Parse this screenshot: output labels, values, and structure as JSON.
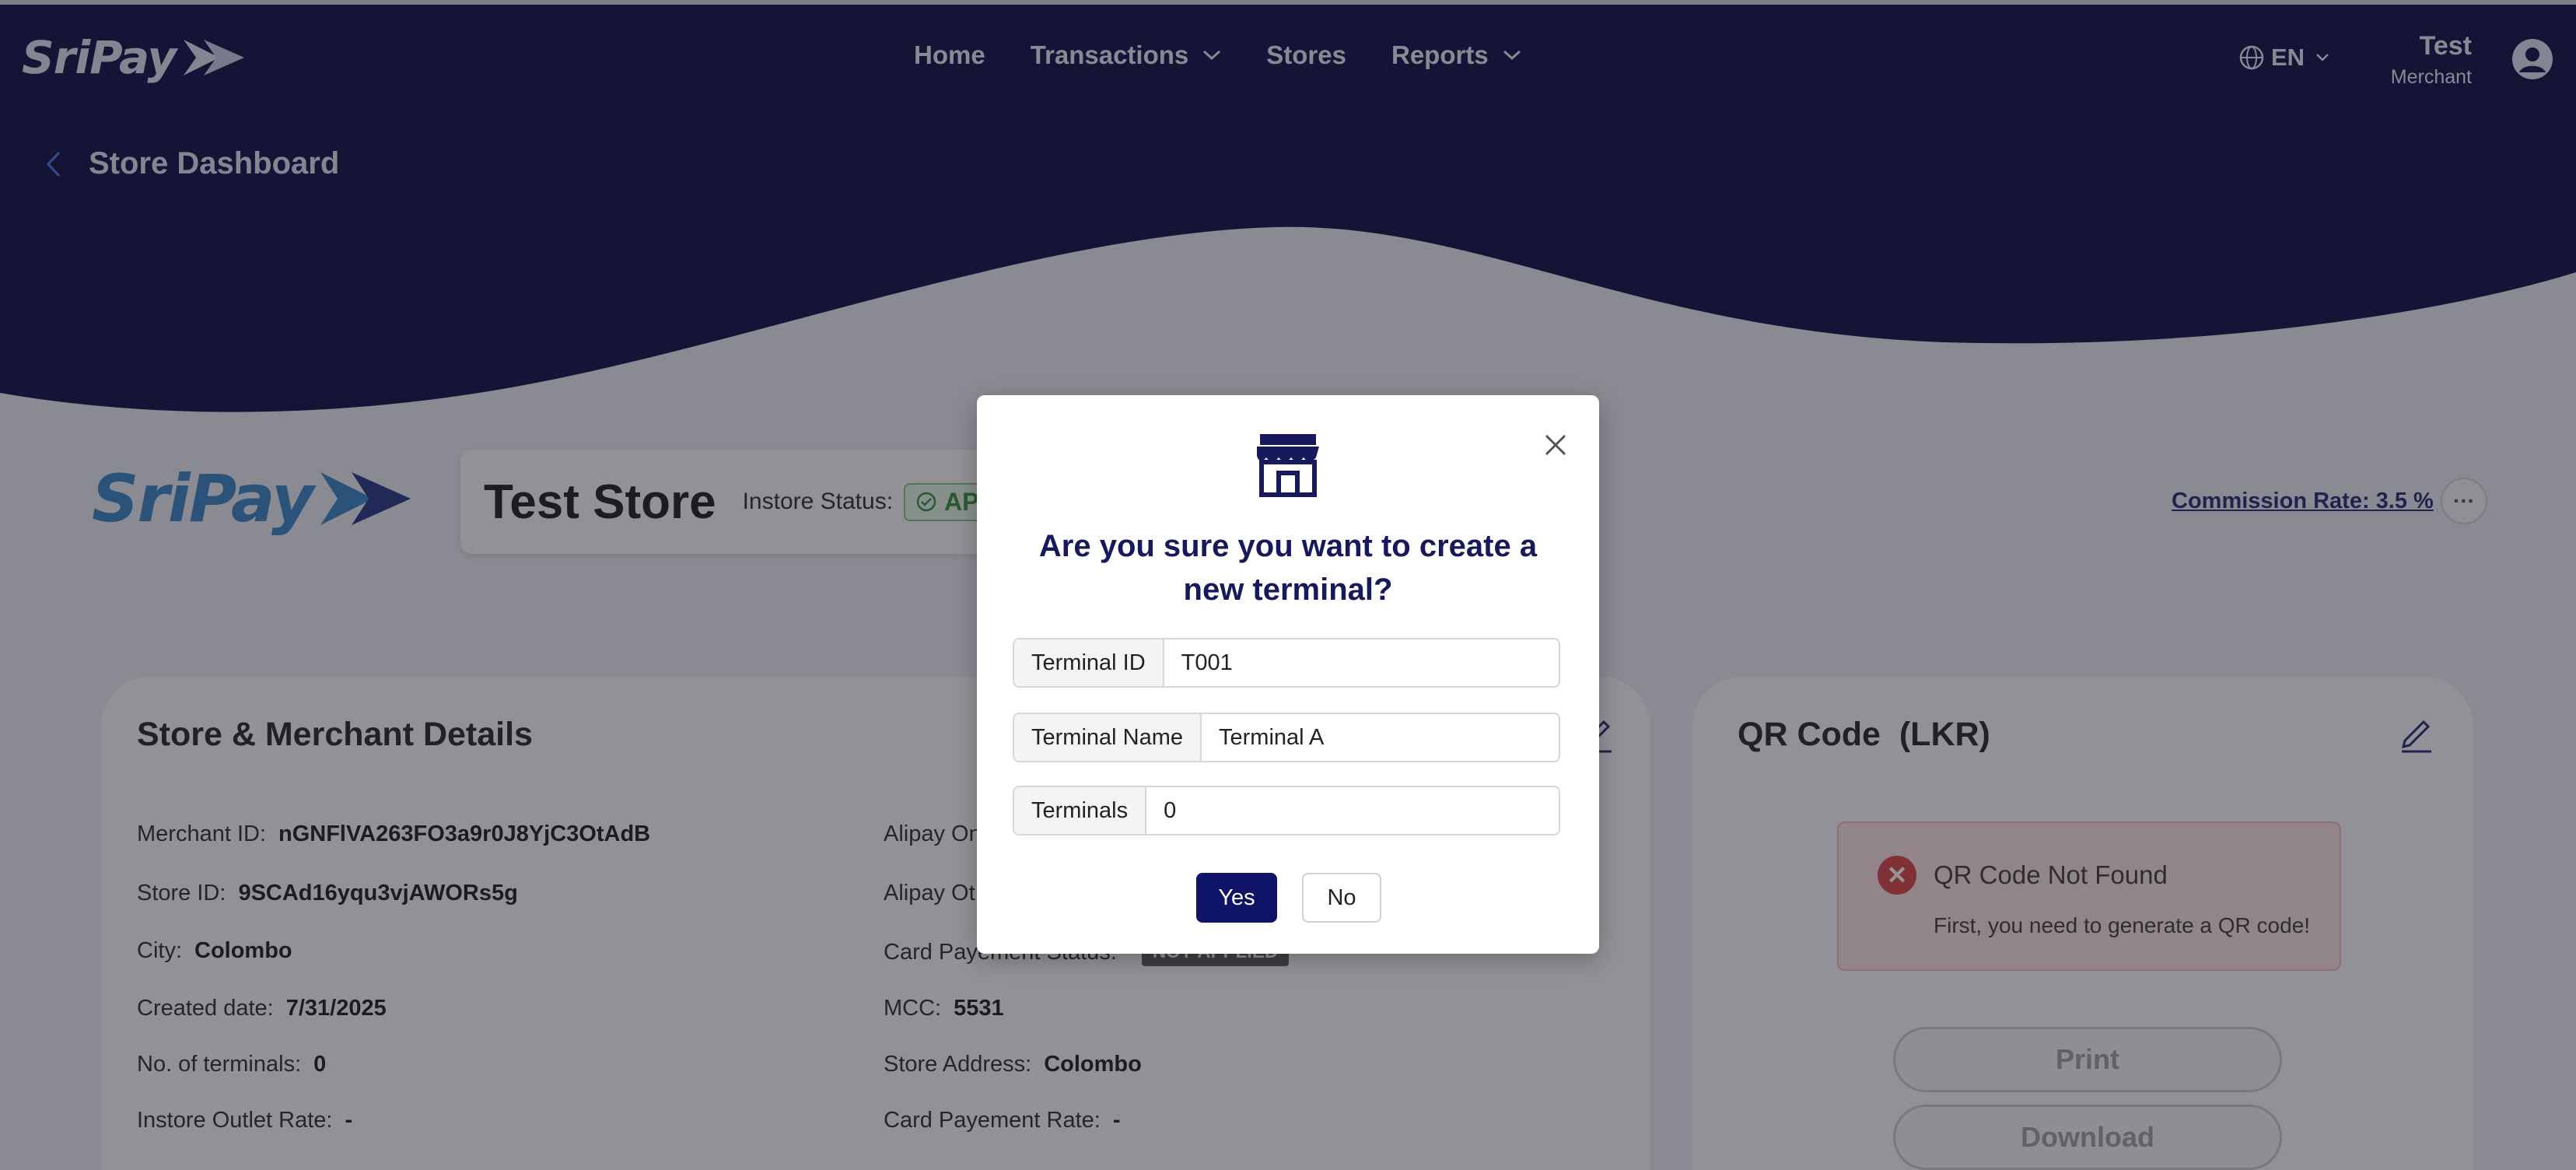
{
  "brand": {
    "name": "SriPay"
  },
  "nav": {
    "items": [
      {
        "label": "Home",
        "dropdown": false
      },
      {
        "label": "Transactions",
        "dropdown": true
      },
      {
        "label": "Stores",
        "dropdown": false
      },
      {
        "label": "Reports",
        "dropdown": true
      }
    ],
    "language": "EN",
    "user_name": "Test",
    "user_role": "Merchant"
  },
  "page": {
    "title": "Store Dashboard"
  },
  "store": {
    "name": "Test Store",
    "instore_status_label": "Instore Status:",
    "instore_status_value": "AP",
    "commission": "Commission Rate: 3.5 %",
    "more": "···"
  },
  "details": {
    "title": "Store & Merchant Details",
    "left": [
      {
        "label": "Merchant ID:",
        "value": "nGNFlVA263FO3a9r0J8YjC3OtAdB"
      },
      {
        "label": "Store ID:",
        "value": "9SCAd16yqu3vjAWORs5g"
      },
      {
        "label": "City:",
        "value": "Colombo"
      },
      {
        "label": "Created date:",
        "value": "7/31/2025"
      },
      {
        "label": "No. of terminals:",
        "value": "0"
      },
      {
        "label": "Instore Outlet Rate:",
        "value": "-"
      }
    ],
    "right": [
      {
        "label": "Alipay On",
        "value": ""
      },
      {
        "label": "Alipay Ot",
        "value": ""
      },
      {
        "label": "Card Payement Status:",
        "value": "NOT-APPLIED"
      },
      {
        "label": "MCC:",
        "value": "5531"
      },
      {
        "label": "Store Address:",
        "value": "Colombo"
      },
      {
        "label": "Card Payement Rate:",
        "value": "-"
      }
    ]
  },
  "qr": {
    "title": "QR Code",
    "currency": "(LKR)",
    "alert_title": "QR Code Not Found",
    "alert_message": "First, you need to generate a QR code!",
    "print_label": "Print",
    "download_label": "Download"
  },
  "modal": {
    "heading": "Are you sure you want to create a new terminal?",
    "fields": [
      {
        "label": "Terminal ID",
        "value": "T001"
      },
      {
        "label": "Terminal Name",
        "value": "Terminal A"
      },
      {
        "label": "Terminals",
        "value": "0"
      }
    ],
    "yes_label": "Yes",
    "no_label": "No"
  },
  "colors": {
    "navy": "#01023a",
    "primary_button": "#0f1466",
    "status_green": "#2c8a30",
    "error_red": "#d93a3a"
  }
}
